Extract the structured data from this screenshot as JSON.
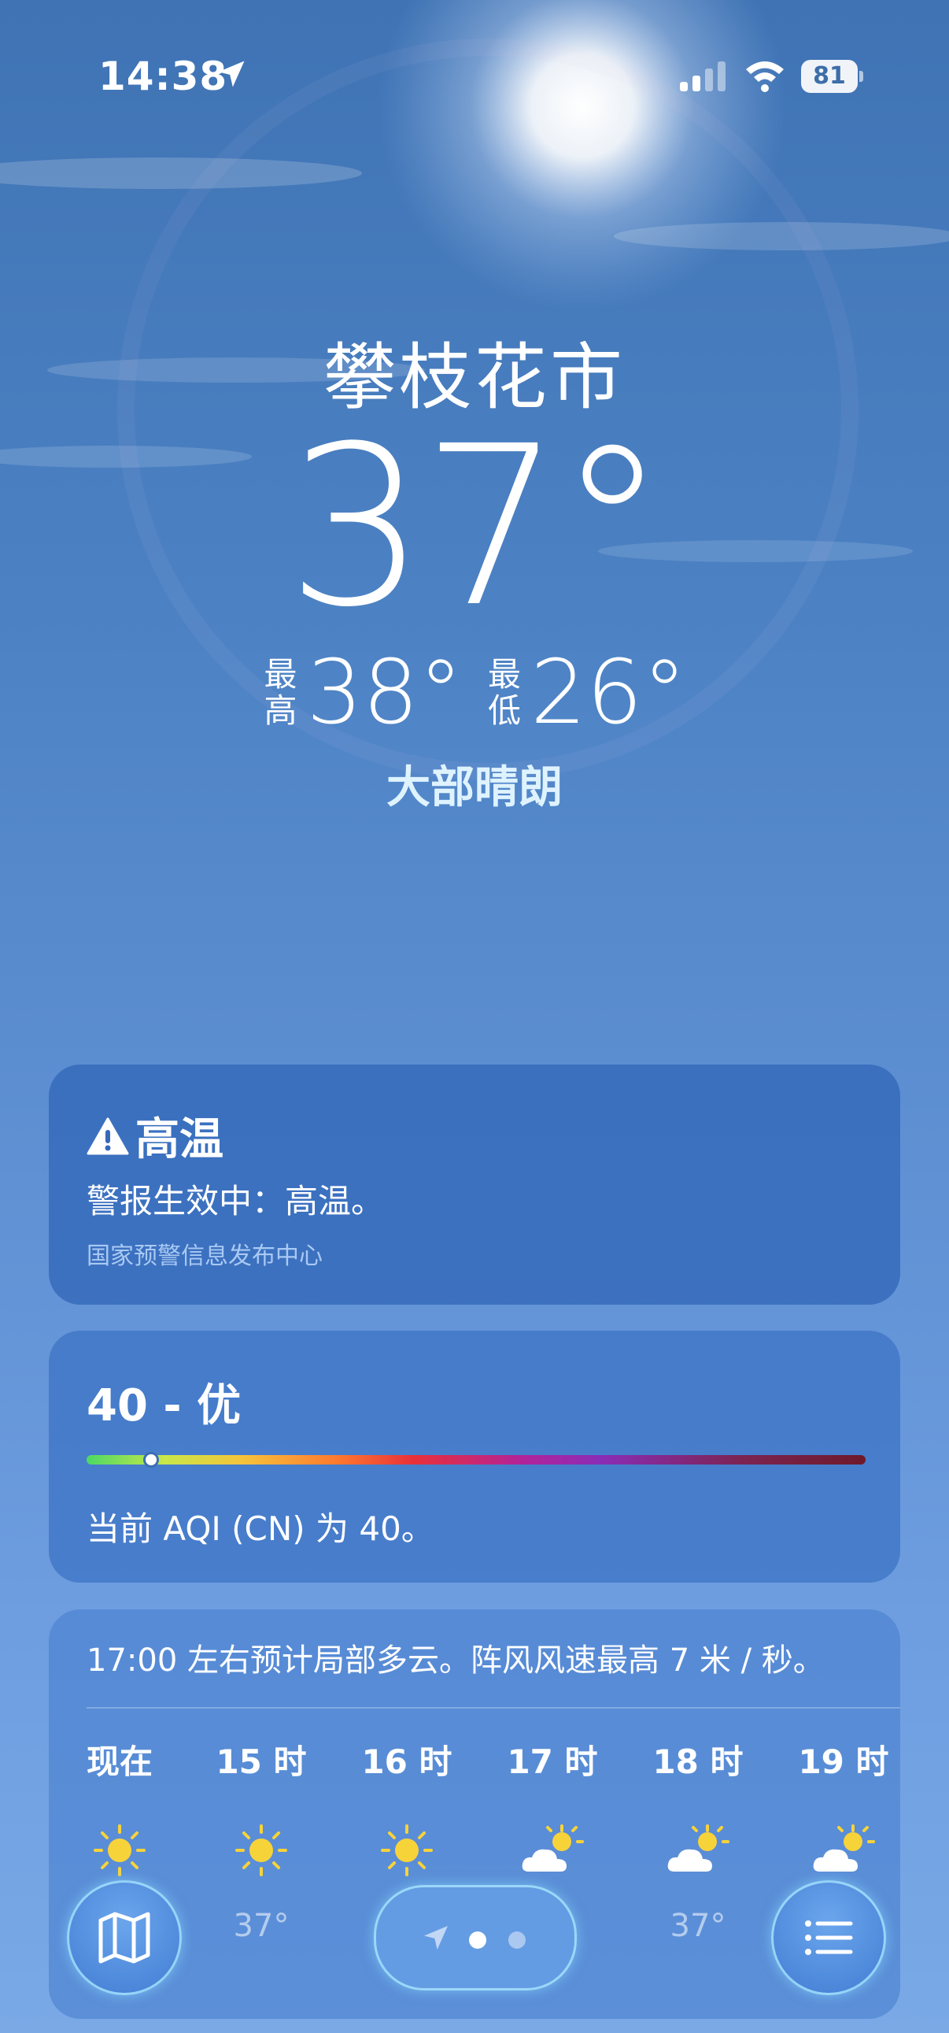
{
  "status_bar": {
    "time": "14:38",
    "battery": "81",
    "icons": [
      "location-arrow-icon",
      "signal-icon",
      "wifi-icon",
      "battery-icon"
    ]
  },
  "weather": {
    "city": "攀枝花市",
    "temperature": "37°",
    "high_label": "最高",
    "high": "38°",
    "low_label": "最低",
    "low": "26°",
    "condition": "大部晴朗"
  },
  "alert": {
    "icon": "warning-icon",
    "title": "高温",
    "message": "警报生效中：高温。",
    "source": "国家预警信息发布中心"
  },
  "air_quality": {
    "value_text": "40 - 优",
    "index": 40,
    "index_max": 500,
    "description": "当前 AQI (CN) 为 40。"
  },
  "hourly": {
    "summary": "17:00 左右预计局部多云。阵风风速最高 7 米 / 秒。",
    "hours": [
      {
        "label": "现在",
        "icon": "sun-icon",
        "temp": ""
      },
      {
        "label": "15 时",
        "icon": "sun-icon",
        "temp": "37°"
      },
      {
        "label": "16 时",
        "icon": "sun-icon",
        "temp": ""
      },
      {
        "label": "17 时",
        "icon": "partly-cloudy-icon",
        "temp": ""
      },
      {
        "label": "18 时",
        "icon": "partly-cloudy-icon",
        "temp": "37°"
      },
      {
        "label": "19 时",
        "icon": "partly-cloudy-icon",
        "temp": ""
      }
    ]
  },
  "bottom_bar": {
    "map_icon": "map-icon",
    "list_icon": "list-icon",
    "page_indicator": {
      "pages": 2,
      "current": 1
    }
  },
  "colors": {
    "sky_top": "#3f73b4",
    "sky_bottom": "#7aa9e6",
    "condition_text": "#dff3ff",
    "alert_source": "#a9c9f3",
    "sun_yellow": "#f7d33a"
  }
}
